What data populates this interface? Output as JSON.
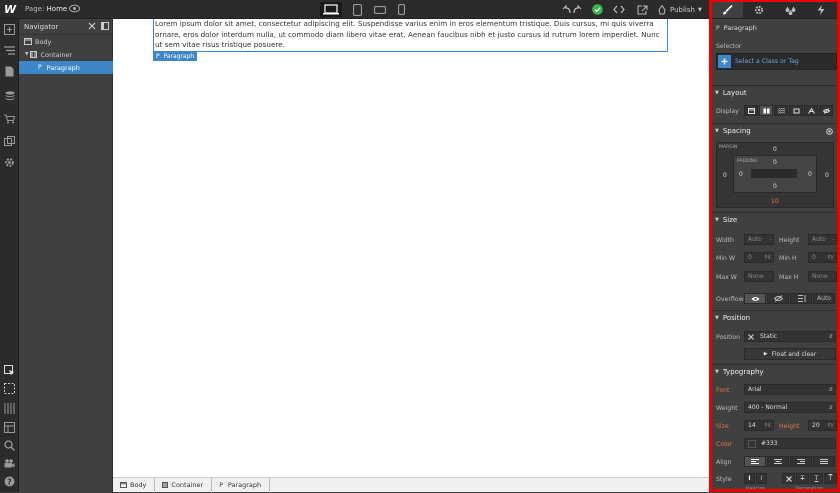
{
  "topbar": {
    "page_label": "Page:",
    "page_name": "Home",
    "publish_label": "Publish"
  },
  "navigator": {
    "title": "Navigator",
    "items": [
      {
        "label": "Body",
        "level": 0
      },
      {
        "label": "Container",
        "level": 1
      },
      {
        "label": "Paragraph",
        "level": 2,
        "tag": "P",
        "selected": true
      }
    ]
  },
  "canvas": {
    "paragraph_text": "Lorem ipsum dolor sit amet, consectetur adipiscing elit. Suspendisse varius enim in eros elementum tristique. Duis cursus, mi quis viverra ornare, eros dolor interdum nulla, ut commodo diam libero vitae erat. Aenean faucibus nibh et justo cursus id rutrum lorem imperdiet. Nunc ut sem vitae risus tristique posuere.",
    "selected_tag": "P",
    "selected_label": "Paragraph"
  },
  "breadcrumbs": [
    {
      "label": "Body"
    },
    {
      "label": "Container"
    },
    {
      "tag": "P",
      "label": "Paragraph"
    }
  ],
  "panel": {
    "element_tag": "P",
    "element_name": "Paragraph",
    "selector_label": "Selector",
    "selector_placeholder": "Select a Class or Tag",
    "layout": {
      "title": "Layout",
      "display_label": "Display"
    },
    "spacing": {
      "title": "Spacing",
      "margin_label": "MARGIN",
      "padding_label": "PADDING",
      "margin": {
        "top": "0",
        "right": "0",
        "bottom": "10",
        "left": "0"
      },
      "padding": {
        "top": "0",
        "right": "0",
        "bottom": "0",
        "left": "0"
      }
    },
    "size": {
      "title": "Size",
      "width_label": "Width",
      "width_value": "Auto",
      "height_label": "Height",
      "height_value": "Auto",
      "minw_label": "Min W",
      "minw_value": "0",
      "minw_unit": "PX",
      "minh_label": "Min H",
      "minh_value": "0",
      "minh_unit": "PX",
      "maxw_label": "Max W",
      "maxw_value": "None",
      "maxh_label": "Max H",
      "maxh_value": "None",
      "overflow_label": "Overflow",
      "overflow_auto": "Auto"
    },
    "position": {
      "title": "Position",
      "position_label": "Position",
      "position_value": "Static",
      "float_label": "Float and clear"
    },
    "typography": {
      "title": "Typography",
      "font_label": "Font",
      "font_value": "Arial",
      "weight_label": "Weight",
      "weight_value": "400 - Normal",
      "size_label": "Size",
      "size_value": "14",
      "size_unit": "PX",
      "height_label": "Height",
      "height_value": "20",
      "height_unit": "PX",
      "color_label": "Color",
      "color_value": "#333",
      "align_label": "Align",
      "style_label": "Style",
      "italicize_label": "Italicize",
      "decoration_label": "Decoration"
    }
  },
  "colors": {
    "accent": "#3d87c9",
    "highlight_border": "#e00000",
    "success": "#3bb54a",
    "override_label": "#e8743b"
  }
}
